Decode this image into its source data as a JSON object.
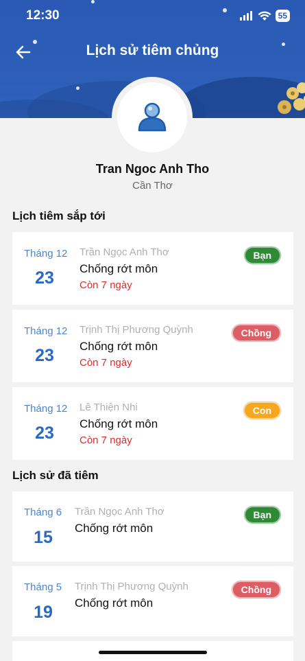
{
  "status_bar": {
    "time": "12:30",
    "battery": "55"
  },
  "header": {
    "title": "Lịch sử tiêm chủng"
  },
  "profile": {
    "name": "Tran Ngoc Anh Tho",
    "city": "Cần Thơ"
  },
  "upcoming": {
    "title": "Lịch tiêm sắp tới",
    "items": [
      {
        "month": "Tháng 12",
        "day": "23",
        "person": "Trần Ngọc Anh Thơ",
        "vaccine": "Chống rớt môn",
        "countdown": "Còn 7 ngày",
        "badge": "Bạn"
      },
      {
        "month": "Tháng 12",
        "day": "23",
        "person": "Trịnh Thị Phương Quỳnh",
        "vaccine": "Chống rớt môn",
        "countdown": "Còn 7 ngày",
        "badge": "Chồng"
      },
      {
        "month": "Tháng 12",
        "day": "23",
        "person": "Lê Thiện Nhi",
        "vaccine": "Chống rớt môn",
        "countdown": "Còn 7 ngày",
        "badge": "Con"
      }
    ]
  },
  "history": {
    "title": "Lịch sử đã tiêm",
    "items": [
      {
        "month": "Tháng 6",
        "day": "15",
        "person": "Trần Ngọc Anh Thơ",
        "vaccine": "Chống rớt môn",
        "badge": "Bạn"
      },
      {
        "month": "Tháng 5",
        "day": "19",
        "person": "Trịnh Thị Phương Quỳnh",
        "vaccine": "Chống rớt môn",
        "badge": "Chồng"
      }
    ]
  },
  "colors": {
    "header_blue": "#2d5fb8",
    "badge_green": "#2f8a35",
    "badge_red": "#db5e64",
    "badge_orange": "#f5a81e",
    "countdown_red": "#e02a2a",
    "date_blue": "#2a69bf"
  },
  "icons": [
    "back-arrow-icon",
    "user-avatar-icon",
    "signal-icon",
    "wifi-icon",
    "battery-icon"
  ]
}
